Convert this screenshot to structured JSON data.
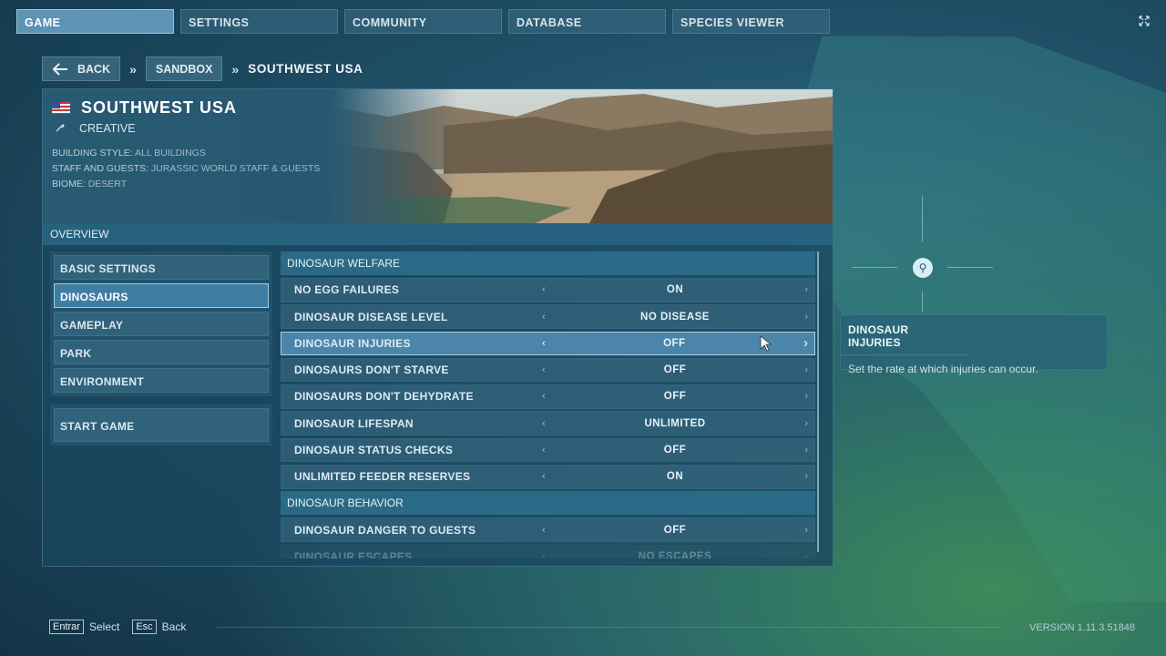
{
  "topnav": {
    "tabs": [
      {
        "label": "GAME",
        "active": true
      },
      {
        "label": "SETTINGS",
        "active": false
      },
      {
        "label": "COMMUNITY",
        "active": false
      },
      {
        "label": "DATABASE",
        "active": false
      },
      {
        "label": "SPECIES VIEWER",
        "active": false
      }
    ],
    "close_icon": "fullscreen-toggle-icon"
  },
  "breadcrumb": {
    "back_label": "BACK",
    "sandbox_label": "SANDBOX",
    "current": "SOUTHWEST USA"
  },
  "map": {
    "title": "SOUTHWEST USA",
    "mode": "CREATIVE",
    "building_style_key": "BUILDING STYLE:",
    "building_style_value": "ALL BUILDINGS",
    "staff_key": "STAFF AND GUESTS:",
    "staff_value": "JURASSIC WORLD STAFF & GUESTS",
    "biome_key": "BIOME:",
    "biome_value": "DESERT"
  },
  "overview_label": "OVERVIEW",
  "menu": {
    "items": [
      {
        "label": "BASIC SETTINGS",
        "active": false
      },
      {
        "label": "DINOSAURS",
        "active": true
      },
      {
        "label": "GAMEPLAY",
        "active": false
      },
      {
        "label": "PARK",
        "active": false
      },
      {
        "label": "ENVIRONMENT",
        "active": false
      }
    ],
    "start_label": "START GAME"
  },
  "settings": {
    "welfare_header": "DINOSAUR WELFARE",
    "behavior_header": "DINOSAUR BEHAVIOR",
    "rows": [
      {
        "label": "NO EGG FAILURES",
        "value": "ON"
      },
      {
        "label": "DINOSAUR DISEASE LEVEL",
        "value": "NO DISEASE"
      },
      {
        "label": "DINOSAUR INJURIES",
        "value": "OFF"
      },
      {
        "label": "DINOSAURS DON'T STARVE",
        "value": "OFF"
      },
      {
        "label": "DINOSAURS DON'T DEHYDRATE",
        "value": "OFF"
      },
      {
        "label": "DINOSAUR LIFESPAN",
        "value": "UNLIMITED"
      },
      {
        "label": "DINOSAUR STATUS CHECKS",
        "value": "OFF"
      },
      {
        "label": "UNLIMITED FEEDER RESERVES",
        "value": "ON"
      },
      {
        "label": "DINOSAUR DANGER TO GUESTS",
        "value": "OFF"
      },
      {
        "label": "DINOSAUR ESCAPES",
        "value": "NO ESCAPES"
      }
    ]
  },
  "info": {
    "title": "DINOSAUR INJURIES",
    "description": "Set the rate at which injuries can occur."
  },
  "hints": {
    "select_key": "Entrar",
    "select_label": "Select",
    "back_key": "Esc",
    "back_label": "Back"
  },
  "version": "VERSION 1.11.3.51848",
  "colors": {
    "accent": "#5d93b5",
    "active_row": "#4b86aa"
  }
}
